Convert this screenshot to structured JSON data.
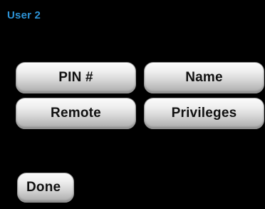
{
  "header": {
    "title": "User 2",
    "title_color": "#2d93d6"
  },
  "buttons": {
    "pin_label": "PIN #",
    "name_label": "Name",
    "remote_label": "Remote",
    "privileges_label": "Privileges",
    "done_label": "Done"
  },
  "colors": {
    "background": "#000000",
    "button_text": "#111111"
  }
}
